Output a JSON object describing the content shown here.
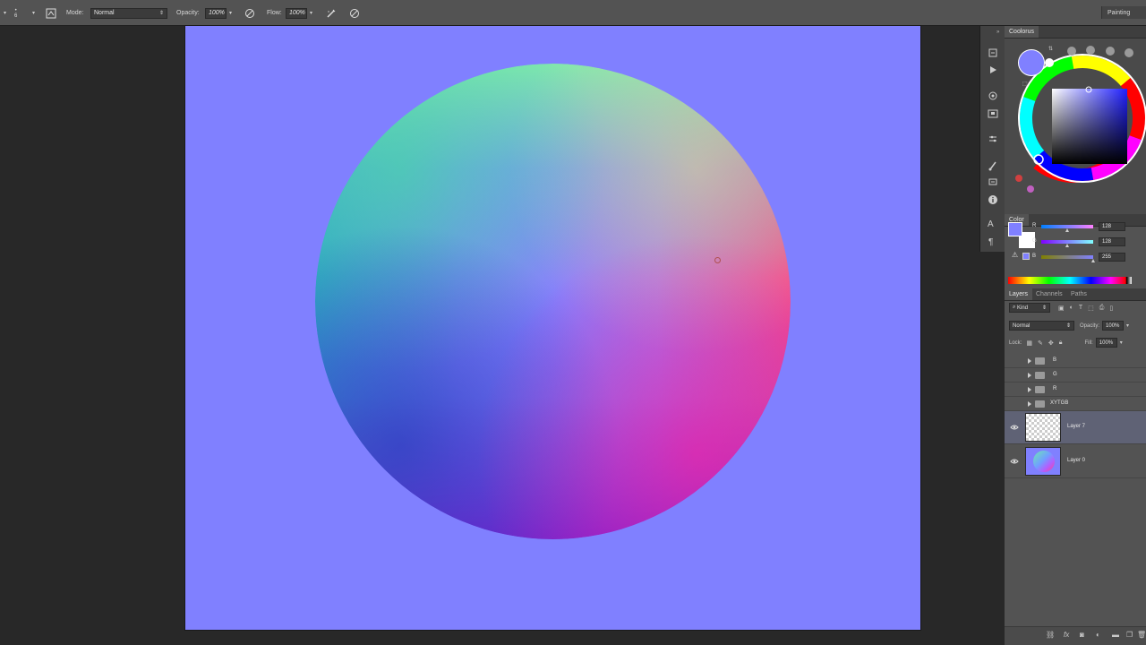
{
  "options_bar": {
    "mode_label": "Mode:",
    "mode_value": "Normal",
    "opacity_label": "Opacity:",
    "opacity_value": "100%",
    "flow_label": "Flow:",
    "flow_value": "100%",
    "brush_size": "6",
    "workspace": "Painting"
  },
  "canvas": {
    "background_color": "#8080ff"
  },
  "coolorus": {
    "title": "Coolorus",
    "fg_color": "#8080ff",
    "bg_color": "#ffffff"
  },
  "color_panel": {
    "title": "Color",
    "sliders": [
      {
        "label": "R",
        "value": "128"
      },
      {
        "label": "G",
        "value": "128"
      },
      {
        "label": "B",
        "value": "255"
      }
    ]
  },
  "layers_panel": {
    "tabs": [
      "Layers",
      "Channels",
      "Paths"
    ],
    "kind_filter": "Kind",
    "blend_mode": "Normal",
    "opacity_label": "Opacity:",
    "opacity_value": "100%",
    "lock_label": "Lock:",
    "fill_label": "Fill:",
    "fill_value": "100%",
    "groups": [
      "B",
      "G",
      "R",
      "XYTGB"
    ],
    "layers": [
      {
        "name": "Layer 7",
        "selected": true
      },
      {
        "name": "Layer 0",
        "selected": false
      }
    ]
  },
  "icons": {
    "tool": "brush-icon",
    "airbrush": "airbrush-icon",
    "pressure": "pressure-icon",
    "eye": "eye-icon",
    "folder": "folder-icon"
  }
}
